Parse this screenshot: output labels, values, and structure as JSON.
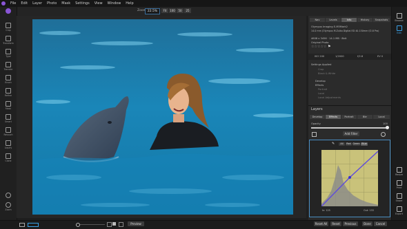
{
  "menu": [
    "File",
    "Edit",
    "Layer",
    "Photo",
    "Mask",
    "Settings",
    "View",
    "Window",
    "Help"
  ],
  "zoom": {
    "label": "Zoom",
    "value": "22.5%",
    "buttons": [
      "Fit",
      "100",
      "50",
      "25"
    ]
  },
  "left_tools": [
    "Crop",
    "Transform",
    "Type",
    "Transfer",
    "Brush",
    "Refine",
    "Mask",
    "Smart",
    "Retouch",
    "Liquify",
    "Clone",
    "Zoom"
  ],
  "right_tools": [
    "Browse",
    "Edit",
    "Resize",
    "Print",
    "Share",
    "Export"
  ],
  "panel": {
    "top_tabs": [
      "Nav",
      "Levels",
      "Info",
      "History",
      "Snapshots"
    ],
    "selected_top_tab": "Info",
    "camera": "Olympus Imaging E-M5Mark2",
    "lens": "14.0 mm (Olympus M.Zuiko Digital ED 40-150mm f/2.8 Pro)",
    "dims": "4608 x 3456 · 14.1 MB · 8bit",
    "original_label": "Original Photo",
    "exif": [
      "ISO 200",
      "1/2000",
      "f/2.8",
      "EV 0"
    ],
    "settings_applied": "Settings Applied",
    "settings_list": [
      "Develop",
      "Effects",
      "Portrait",
      "Local",
      "Crop",
      "Black & White",
      "Local Adjustments"
    ],
    "layers_title": "Layers",
    "layer_tabs": [
      "Develop",
      "Effects",
      "Portrait",
      "Bkr",
      "Local"
    ],
    "opacity_label": "Opacity",
    "opacity_value": "100",
    "add_filter": "Add Filter",
    "curve_channels": [
      "All",
      "Red",
      "Green",
      "Blue"
    ],
    "curve_in": "In: 125",
    "curve_out": "Out: 133"
  },
  "bottom": {
    "preview": "Preview",
    "reset_all": "Reset All",
    "reset": "Reset",
    "previous": "Previous",
    "done": "Done",
    "cancel": "Cancel"
  },
  "colors": {
    "accent": "#3aa2e8",
    "curve": "#5e4bdc",
    "water": "#1b7fae"
  }
}
